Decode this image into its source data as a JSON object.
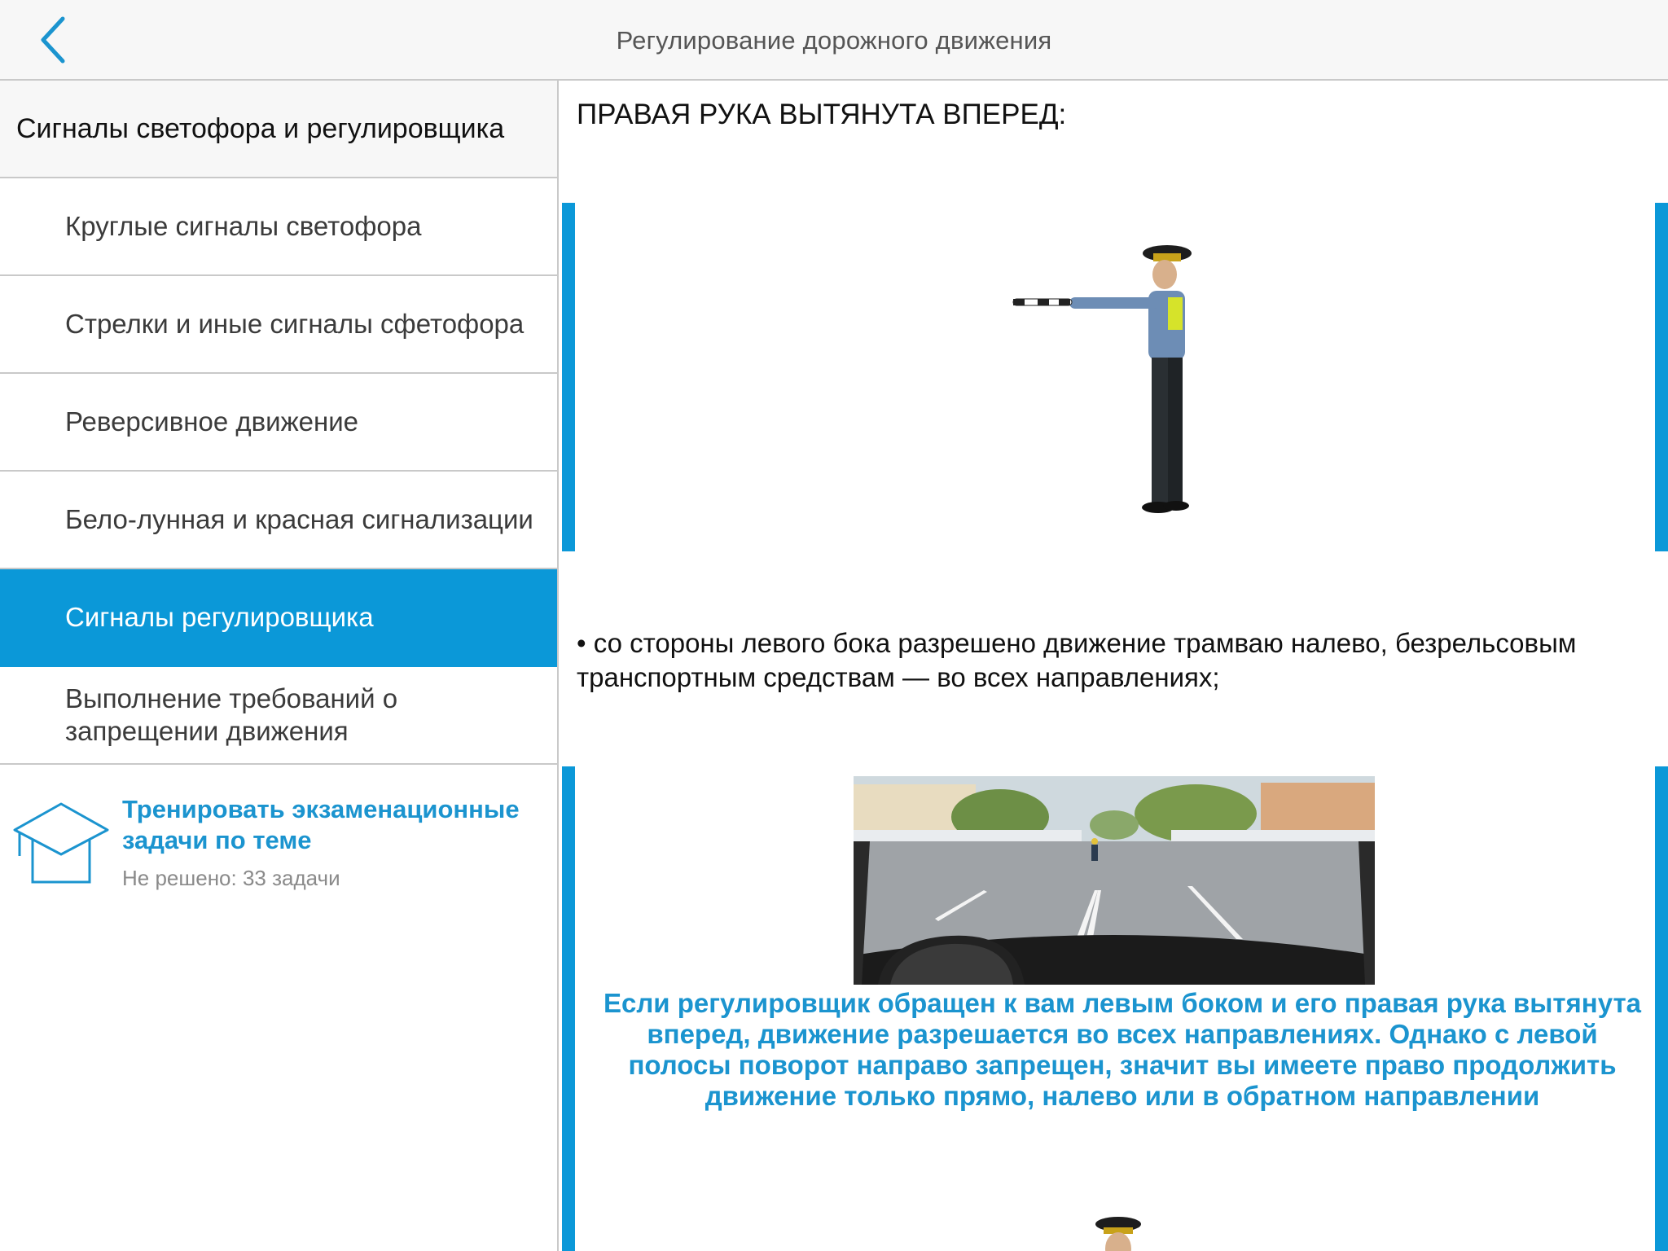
{
  "header": {
    "title": "Регулирование дорожного движения",
    "back_icon": "chevron-left-icon"
  },
  "sidebar": {
    "section_title": "Сигналы светофора и регулировщика",
    "items": [
      {
        "label": "Круглые сигналы светофора",
        "active": false
      },
      {
        "label": "Стрелки и иные сигналы сфетофора",
        "active": false
      },
      {
        "label": "Реверсивное движение",
        "active": false
      },
      {
        "label": "Бело-лунная и красная сигнализации",
        "active": false
      },
      {
        "label": "Сигналы регулировщика",
        "active": true
      },
      {
        "label": "Выполнение требований о запрещении движения",
        "active": false
      }
    ],
    "training": {
      "icon": "graduation-cap-icon",
      "title": "Тренировать экзаменационные задачи по теме",
      "status": "Не решено: 33 задачи"
    }
  },
  "content": {
    "heading": "ПРАВАЯ РУКА ВЫТЯНУТА ВПЕРЕД:",
    "bullet": "• со стороны левого бока разрешено движение трамваю налево, безрельсовым транспортным средствам — во всех направлениях;",
    "caption": "Если регулировщик обращен к вам левым боком и его правая рука вытянута вперед, движение разрешается во всех направлениях. Однако с левой полосы поворот направо запрещен, значит вы имеете право продолжить движение только прямо, налево или в обратном направлении"
  },
  "colors": {
    "accent": "#0b98d8",
    "link": "#1b94cf",
    "topbar_bg": "#f7f7f7",
    "divider": "#c9c9c9"
  }
}
